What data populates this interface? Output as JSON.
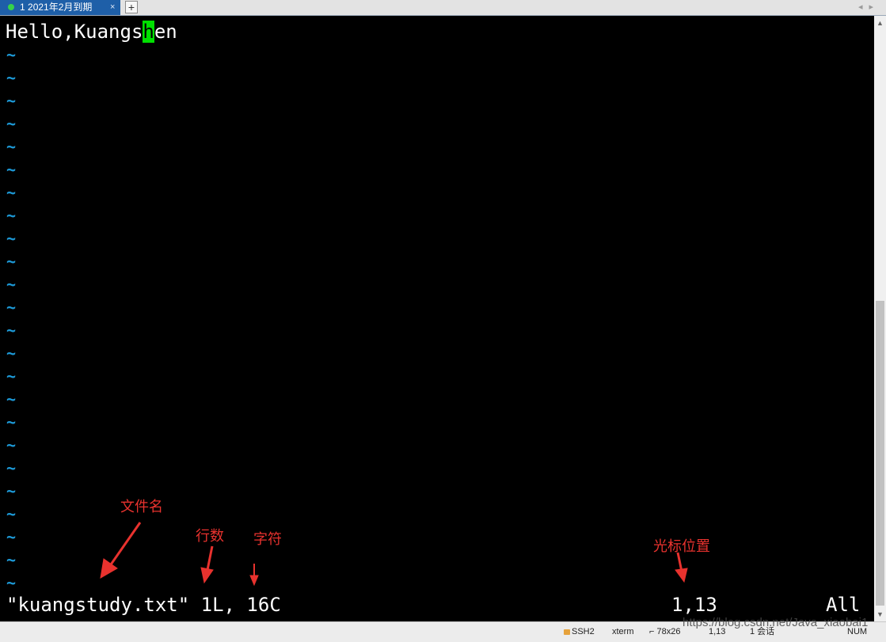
{
  "tab": {
    "number": "1",
    "title": "2021年2月到期",
    "close_glyph": "×",
    "new_tab_glyph": "+"
  },
  "tab_nav": {
    "prev": "◂",
    "next": "▸"
  },
  "editor": {
    "line1_before_cursor": "Hello,Kuangs",
    "cursor_char": "h",
    "line1_after_cursor": "en",
    "tilde": "~",
    "status_file": "\"kuangstudy.txt\" 1L, 16C",
    "cursor_position": "1,13",
    "scroll_state": "All"
  },
  "annotations": {
    "filename": "文件名",
    "lines": "行数",
    "chars": "字符",
    "cursor_position": "光标位置"
  },
  "statusbar": {
    "protocol": "SSH2",
    "terminal": "xterm",
    "size": "78x26",
    "position": "1,13",
    "sessions": "1 会话",
    "num": "NUM"
  },
  "watermark": "https://blog.csdn.net/Java_xiaobai1",
  "colors": {
    "tab_active": "#1e5fa8",
    "cursor": "#00e000",
    "tilde": "#1d9ad8",
    "annotation": "#e8322e"
  }
}
